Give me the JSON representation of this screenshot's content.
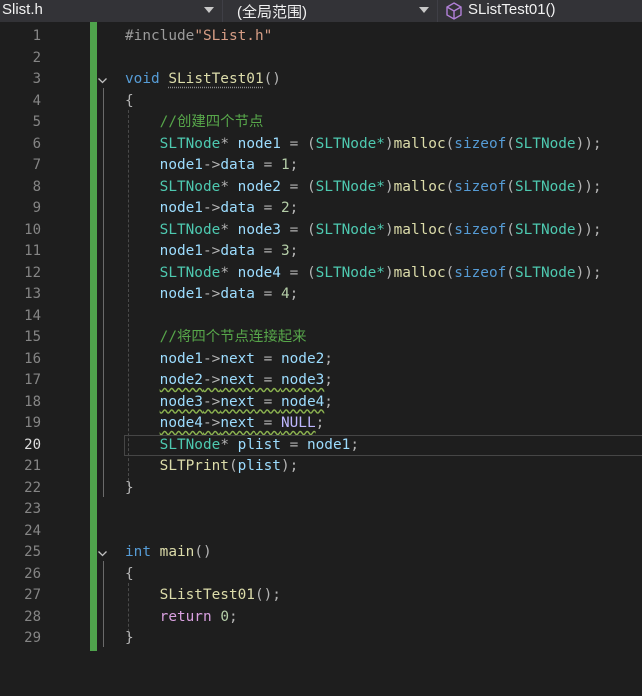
{
  "navbar": {
    "file_label": "Slist.h",
    "scope_label": "(全局范围)",
    "member_label": "SListTest01()",
    "member_icon": "cube-icon"
  },
  "editor": {
    "current_line": "20",
    "line_numbers": [
      "1",
      "2",
      "3",
      "4",
      "5",
      "6",
      "7",
      "8",
      "9",
      "10",
      "11",
      "12",
      "13",
      "14",
      "15",
      "16",
      "17",
      "18",
      "19",
      "20",
      "21",
      "22",
      "23",
      "24",
      "25",
      "26",
      "27",
      "28",
      "29"
    ],
    "tokens": {
      "include_directive": "#include",
      "include_file": "\"SList.h\"",
      "kw_void": "void",
      "fn_test": "SListTest01",
      "parens": "()",
      "brace_open": "{",
      "brace_close": "}",
      "comment_create": "//创建四个节点",
      "comment_link": "//将四个节点连接起来",
      "type_node": "SLTNode",
      "star": "*",
      "cast_open": "(",
      "cast_type": "SLTNode*",
      "cast_close": ")",
      "fn_malloc": "malloc",
      "kw_sizeof": "sizeof",
      "arg_open": "(",
      "arg_close": "));",
      "node1": "node1",
      "node2": "node2",
      "node3": "node3",
      "node4": "node4",
      "eq": " = ",
      "arrow": "->",
      "field_data": "data",
      "field_next": "next",
      "semi": ";",
      "num1": "1",
      "num2": "2",
      "num3": "3",
      "num4": "4",
      "null": "NULL",
      "plist": "plist",
      "fn_print": "SLTPrint",
      "print_tail": ");",
      "kw_int": "int",
      "fn_main": "main",
      "call_tail": "();",
      "kw_return": "return",
      "num0": "0"
    }
  }
}
